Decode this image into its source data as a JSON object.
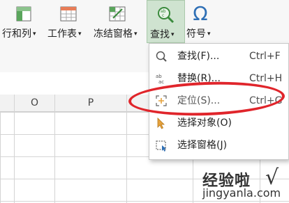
{
  "ribbon": {
    "buttons": [
      {
        "label": "行和列",
        "icon": "row-column-icon",
        "caret": "▾"
      },
      {
        "label": "工作表",
        "icon": "worksheet-icon",
        "caret": "▾"
      },
      {
        "label": "冻结窗格",
        "icon": "freeze-panes-icon",
        "caret": "▾"
      },
      {
        "label": "查找",
        "icon": "find-icon",
        "caret": "▾",
        "active": true
      },
      {
        "label": "符号",
        "icon": "omega-symbol-icon",
        "caret": "▾"
      }
    ]
  },
  "sheet": {
    "columns": [
      "O",
      "P"
    ]
  },
  "menu": {
    "items": [
      {
        "label": "查找(F)...",
        "shortcut": "Ctrl+F",
        "icon": "find-icon"
      },
      {
        "label": "替换(R)...",
        "shortcut": "Ctrl+H",
        "icon": "replace-icon"
      },
      {
        "label": "定位(S)...",
        "shortcut": "Ctrl+G",
        "icon": "goto-icon"
      },
      {
        "label": "选择对象(O)",
        "shortcut": "",
        "icon": "select-object-icon"
      },
      {
        "label": "选择窗格(J)",
        "shortcut": "",
        "icon": "selection-pane-icon"
      }
    ]
  },
  "watermark": {
    "line1": "经验啦",
    "check": "√",
    "line2": "jingyanla.com"
  },
  "colors": {
    "highlight_circle": "#e0252b",
    "active_button_bg": "#cfe3d0",
    "accent_green": "#3a8a3c",
    "icon_blue": "#2e6fb5"
  }
}
